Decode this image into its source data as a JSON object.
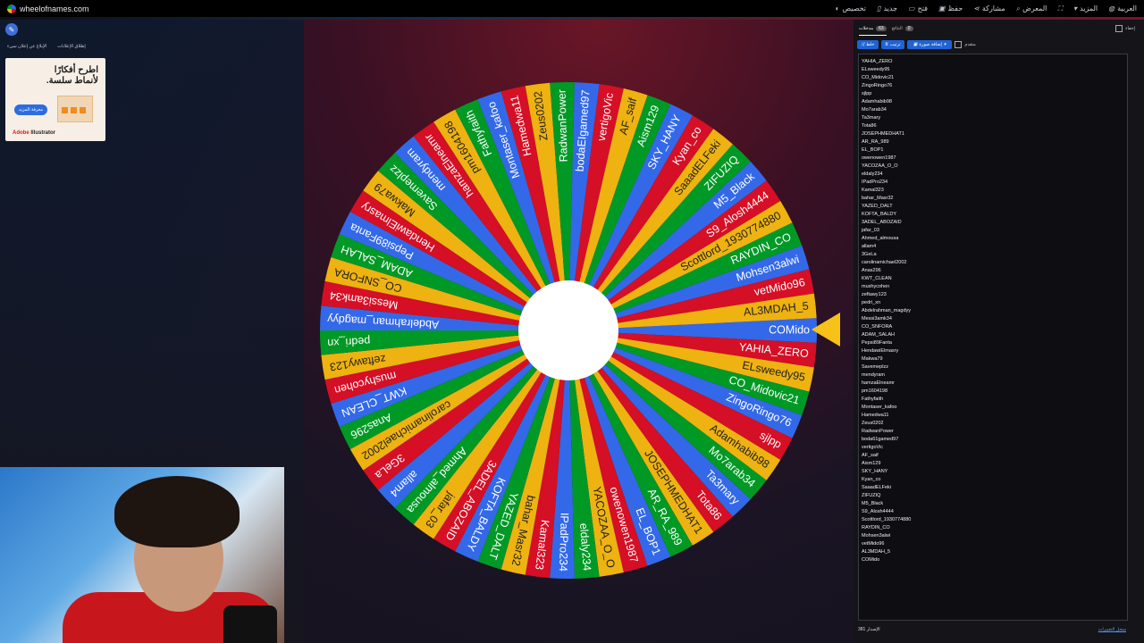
{
  "site": {
    "url": "wheelofnames.com"
  },
  "topbar": {
    "items": [
      {
        "icon": "palette-icon",
        "label": "تخصيص"
      },
      {
        "icon": "file-icon",
        "label": "جديد"
      },
      {
        "icon": "folder-icon",
        "label": "فتح"
      },
      {
        "icon": "save-icon",
        "label": "حفظ"
      },
      {
        "icon": "share-icon",
        "label": "مشاركة"
      },
      {
        "icon": "search-icon",
        "label": "المعرض"
      },
      {
        "icon": "fullscreen-icon",
        "label": ""
      },
      {
        "icon": "chevron-down-icon",
        "label": "المزيد"
      },
      {
        "icon": "globe-icon",
        "label": "العربية"
      }
    ]
  },
  "left": {
    "ad_links": [
      "إطلاق الإعلانات",
      "الإبلاغ عن إعلان سيء"
    ],
    "ad": {
      "headline": "اطرح أفكارًا لأنماط سلسة.",
      "cta": "معرفة المزيد",
      "brand_prefix": "Adobe",
      "brand_name": "Illustrator"
    }
  },
  "wheel": {
    "colors": [
      "#3369e8",
      "#d50f25",
      "#eeb211",
      "#009925"
    ],
    "labels": [
      "COMido",
      "YAHIA_ZERO",
      "ELsweedy95",
      "CO_Midovic21",
      "ZingoRingo76",
      "sjlpp",
      "Adamhabib98",
      "Mo7arab34",
      "Ta3mary",
      "Tota86",
      "JOSEPHMEDHAT1",
      "AR_RA_989",
      "EL_BOP1",
      "owenowen1987",
      "YACOZAA_O_O",
      "eldaly234",
      "IPadPro234",
      "Kamal323",
      "bahar_Masr32",
      "YAZED_DALT",
      "KOFTA_BALDY",
      "3ADEL_ABOZAID",
      "jafar_03",
      "Ahmed_almousa",
      "allam4",
      "3GeLa",
      "carolinamichael2002",
      "Anas296",
      "KWT_CLEAN",
      "mushycohen",
      "zeftawy123",
      "pedri_xn",
      "Abdelrahman_magdyy",
      "Messi3amk34",
      "CO_SNFORA",
      "ADAM_SALAH",
      "Pepsi89Fanta",
      "HendawiElmasry",
      "Makwa79",
      "Savemeplzz",
      "mendyram",
      "hamzaElneamr",
      "pm1604198",
      "Fathyfaith",
      "Montaser_kafoo",
      "Hamedwa11",
      "Zeus0202",
      "RadwanPower",
      "bodaEIgamed97",
      "vertigoVic",
      "AF_saif",
      "Aism129",
      "SKY_HANY",
      "Kyan_co",
      "SaaadELFeki",
      "ZIFUZIQ",
      "M5_Black",
      "S9_Alosh4444",
      "Scottlord_1930774880",
      "RAYDIN_CO",
      "Mohsen3alwi",
      "vetMido96",
      "AL3MDAH_5"
    ]
  },
  "panel": {
    "tab_entries": "مدخلات",
    "tab_entries_count": "63",
    "tab_results": "النتائج",
    "tab_results_count": "0",
    "hide_label": "إخفاء",
    "btn_shuffle": "خلط",
    "btn_sort": "ترتيب",
    "btn_add_image": "إضافة صورة",
    "advanced_label": "متقدم",
    "entries": [
      "YAHIA_ZERO",
      "ELsweedy95",
      "CO_Midovic21",
      "ZingoRingo76",
      "sjlpp",
      "Adamhabib98",
      "Mo7arab34",
      "Ta3mary",
      "Tota86",
      "JOSEPHMEDHAT1",
      "AR_RA_989",
      "EL_BOP1",
      "owenowen1987",
      "YACOZAA_O_O",
      "eldaly234",
      "IPadPro234",
      "Kamal323",
      "bahar_Masr32",
      "YAZED_DALT",
      "KOFTA_BALDY",
      "3ADEL_ABOZAID",
      "jafar_03",
      "Ahmed_almousa",
      "allam4",
      "3GeLa",
      "carolinamichael2002",
      "Anas296",
      "KWT_CLEAN",
      "mushycohen",
      "zeftawy123",
      "pedri_xn",
      "Abdelrahman_magdyy",
      "Messi3amk34",
      "CO_SNFORA",
      "ADAM_SALAH",
      "Pepsi89Fanta",
      "HendawiElmasry",
      "Makwa79",
      "Savemeplzz",
      "mendyram",
      "hamzaElneamr",
      "pm1604198",
      "Fathyfaith",
      "Montaser_kafoo",
      "Hamedwa11",
      "Zeus0202",
      "RadwanPower",
      "boda61gamed97",
      "vertigoVic",
      "AF_saif",
      "Aism129",
      "SKY_HANY",
      "Kyan_co",
      "SaaadELFeki",
      "ZIFUZIQ",
      "M5_Black",
      "S9_Alosh4444",
      "Scottlord_1930774880",
      "RAYDIN_CO",
      "Mohsen3alwi",
      "vetMido96",
      "AL3MDAH_5",
      "COMido"
    ],
    "version_label": "الإصدار",
    "version": "381",
    "changelog": "سجل التغييرات"
  }
}
